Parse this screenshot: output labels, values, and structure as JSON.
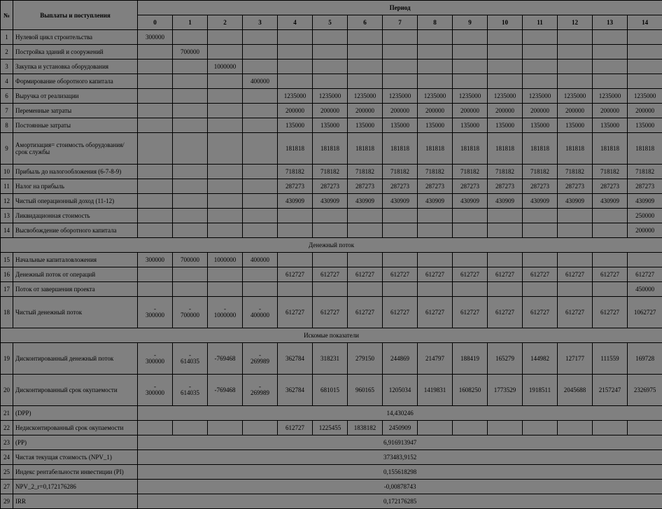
{
  "header": {
    "no": "№",
    "payments": "Выплаты и поступления",
    "period": "Период",
    "periods": [
      "0",
      "1",
      "2",
      "3",
      "4",
      "5",
      "6",
      "7",
      "8",
      "9",
      "10",
      "11",
      "12",
      "13",
      "14"
    ]
  },
  "rows": [
    {
      "no": "1",
      "label": "Нулевой цикл строительства",
      "vals": [
        "300000",
        "",
        "",
        "",
        "",
        "",
        "",
        "",
        "",
        "",
        "",
        "",
        "",
        "",
        ""
      ]
    },
    {
      "no": "2",
      "label": "Постройка зданий и сооружений",
      "vals": [
        "",
        "700000",
        "",
        "",
        "",
        "",
        "",
        "",
        "",
        "",
        "",
        "",
        "",
        "",
        ""
      ]
    },
    {
      "no": "3",
      "label": "Закупка и установка оборудования",
      "vals": [
        "",
        "",
        "1000000",
        "",
        "",
        "",
        "",
        "",
        "",
        "",
        "",
        "",
        "",
        "",
        ""
      ]
    },
    {
      "no": "4",
      "label": "Формирование оборотного капитала",
      "vals": [
        "",
        "",
        "",
        "400000",
        "",
        "",
        "",
        "",
        "",
        "",
        "",
        "",
        "",
        "",
        ""
      ]
    },
    {
      "no": "6",
      "label": "Выручка от реализации",
      "vals": [
        "",
        "",
        "",
        "",
        "1235000",
        "1235000",
        "1235000",
        "1235000",
        "1235000",
        "1235000",
        "1235000",
        "1235000",
        "1235000",
        "1235000",
        "1235000"
      ]
    },
    {
      "no": "7",
      "label": "Переменные затраты",
      "vals": [
        "",
        "",
        "",
        "",
        "200000",
        "200000",
        "200000",
        "200000",
        "200000",
        "200000",
        "200000",
        "200000",
        "200000",
        "200000",
        "200000"
      ]
    },
    {
      "no": "8",
      "label": "Постоянные затраты",
      "vals": [
        "",
        "",
        "",
        "",
        "135000",
        "135000",
        "135000",
        "135000",
        "135000",
        "135000",
        "135000",
        "135000",
        "135000",
        "135000",
        "135000"
      ]
    },
    {
      "no": "9",
      "label": "Амортизация= стоимость оборудования/срок службы",
      "tall": true,
      "vals": [
        "",
        "",
        "",
        "",
        "181818",
        "181818",
        "181818",
        "181818",
        "181818",
        "181818",
        "181818",
        "181818",
        "181818",
        "181818",
        "181818"
      ]
    },
    {
      "no": "10",
      "label": "Прибыль до налогообложения (6-7-8-9)",
      "vals": [
        "",
        "",
        "",
        "",
        "718182",
        "718182",
        "718182",
        "718182",
        "718182",
        "718182",
        "718182",
        "718182",
        "718182",
        "718182",
        "718182"
      ]
    },
    {
      "no": "11",
      "label": "Налог на прибыль",
      "vals": [
        "",
        "",
        "",
        "",
        "287273",
        "287273",
        "287273",
        "287273",
        "287273",
        "287273",
        "287273",
        "287273",
        "287273",
        "287273",
        "287273"
      ]
    },
    {
      "no": "12",
      "label": "Чистый операционный доход (11-12)",
      "vals": [
        "",
        "",
        "",
        "",
        "430909",
        "430909",
        "430909",
        "430909",
        "430909",
        "430909",
        "430909",
        "430909",
        "430909",
        "430909",
        "430909"
      ]
    },
    {
      "no": "13",
      "label": "Ликвидационная стоимость",
      "vals": [
        "",
        "",
        "",
        "",
        "",
        "",
        "",
        "",
        "",
        "",
        "",
        "",
        "",
        "",
        "250000"
      ]
    },
    {
      "no": "14",
      "label": "Высвобождение оборотного капитала",
      "vals": [
        "",
        "",
        "",
        "",
        "",
        "",
        "",
        "",
        "",
        "",
        "",
        "",
        "",
        "",
        "200000"
      ]
    }
  ],
  "section_cashflow": "Денежный поток",
  "rows_cf": [
    {
      "no": "15",
      "label": "Начальные капиталовложения",
      "vals": [
        "300000",
        "700000",
        "1000000",
        "400000",
        "",
        "",
        "",
        "",
        "",
        "",
        "",
        "",
        "",
        "",
        ""
      ]
    },
    {
      "no": "16",
      "label": "Денежный поток от операций",
      "vals": [
        "",
        "",
        "",
        "",
        "612727",
        "612727",
        "612727",
        "612727",
        "612727",
        "612727",
        "612727",
        "612727",
        "612727",
        "612727",
        "612727"
      ]
    },
    {
      "no": "17",
      "label": "Поток от завершения проекта",
      "vals": [
        "",
        "",
        "",
        "",
        "",
        "",
        "",
        "",
        "",
        "",
        "",
        "",
        "",
        "",
        "450000"
      ]
    },
    {
      "no": "18",
      "label": "Чистый денежный поток",
      "tall": true,
      "vals": [
        "- 300000",
        "- 700000",
        "- 1000000",
        "- 400000",
        "612727",
        "612727",
        "612727",
        "612727",
        "612727",
        "612727",
        "612727",
        "612727",
        "612727",
        "612727",
        "1062727"
      ]
    }
  ],
  "section_indicators": "Искомые показатели",
  "rows_ind": [
    {
      "no": "19",
      "label": "Дисконтированный денежный поток",
      "tall": true,
      "vals": [
        "- 300000",
        "- 614035",
        "-769468",
        "- 269989",
        "362784",
        "318231",
        "279150",
        "244869",
        "214797",
        "188419",
        "165279",
        "144982",
        "127177",
        "111559",
        "169728"
      ]
    },
    {
      "no": "20",
      "label": "Дисконтированный срок окупаемости",
      "tall": true,
      "vals": [
        "- 300000",
        "- 614035",
        "-769468",
        "- 269989",
        "362784",
        "681015",
        "960165",
        "1205034",
        "1419831",
        "1608250",
        "1773529",
        "1918511",
        "2045688",
        "2157247",
        "2326975"
      ]
    }
  ],
  "merged": [
    {
      "no": "21",
      "label": "(DPP)",
      "value": "14,430246"
    },
    {
      "no": "22",
      "label": "Недисконтированный срок окупаемости",
      "type": "partial",
      "vals": [
        "",
        "",
        "",
        "",
        "612727",
        "1225455",
        "1838182",
        "2450909",
        "",
        "",
        "",
        "",
        "",
        "",
        ""
      ]
    },
    {
      "no": "23",
      "label": "(PP)",
      "value": "6,916913947"
    },
    {
      "no": "24",
      "label": "Чистая текущая стоимость (NPV_1)",
      "value": "373483,9152"
    },
    {
      "no": "25",
      "label": "Индекс рентабельности инвестиции (PI)",
      "value": "0,155618298"
    },
    {
      "no": "27",
      "label": "NPV_2_r=0,172176286",
      "value": "-0,00878743"
    },
    {
      "no": "29",
      "label": "IRR",
      "value": "0,172176285"
    }
  ]
}
